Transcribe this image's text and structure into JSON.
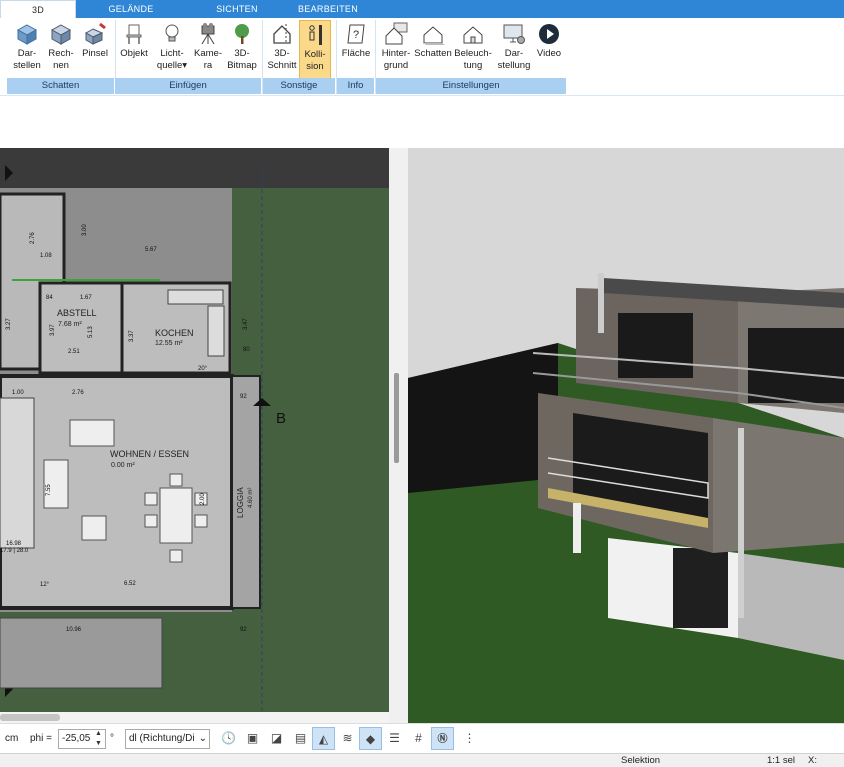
{
  "tabs": {
    "t3d": "3D",
    "gelaende": "GELÄNDE",
    "sichten": "SICHTEN",
    "bearbeiten": "BEARBEITEN"
  },
  "ribbon": {
    "darstellen": [
      "Dar-",
      "stellen"
    ],
    "rechnen": [
      "Rech-",
      "nen"
    ],
    "pinsel": "Pinsel",
    "objekt": "Objekt",
    "lichtquelle": [
      "Licht-",
      "quelle"
    ],
    "kamera": [
      "Kame-",
      "ra"
    ],
    "bitmap": [
      "3D-",
      "Bitmap"
    ],
    "schnitt": [
      "3D-",
      "Schnitt"
    ],
    "kollision": [
      "Kolli-",
      "sion"
    ],
    "flaeche": "Fläche",
    "hintergrund": [
      "Hinter-",
      "grund"
    ],
    "schatten": "Schatten",
    "beleuchtung": [
      "Beleuch-",
      "tung"
    ],
    "darstellung": [
      "Dar-",
      "stellung"
    ],
    "video": "Video",
    "groups": {
      "schatten": "Schatten",
      "einfuegen": "Einfügen",
      "sonstige": "Sonstige",
      "info": "Info",
      "einstellungen": "Einstellungen"
    }
  },
  "plan": {
    "rooms": {
      "abstell": "ABSTELL",
      "abstell_area": "7.68 m²",
      "kochen": "KOCHEN",
      "kochen_area": "12.55 m²",
      "wohnen": "WOHNEN / ESSEN",
      "wohnen_area": "0.00 m²",
      "loggia": "LOGGIA",
      "loggia_area": "4.60 m²"
    },
    "dims": [
      "2.76",
      "3.00",
      "5.67",
      "1.08",
      "84",
      "1.67",
      "3.47",
      "3.37",
      "2.51",
      "80",
      "92",
      "2.76",
      "20°",
      "1.00",
      "7.55",
      "2.00",
      "6.52",
      "10.96",
      "92",
      "12°",
      "16.98",
      "17.9 | 28.0",
      "3.27",
      "3.97",
      "5.13"
    ],
    "section_label": "B"
  },
  "toolbar": {
    "unit": "cm",
    "phi_label": "phi =",
    "phi_value": "-25,05",
    "degree": "°",
    "dl_value": "dl (Richtung/Di"
  },
  "status": {
    "mode": "Selektion",
    "scale": "1:1 sel",
    "x": "X:"
  }
}
